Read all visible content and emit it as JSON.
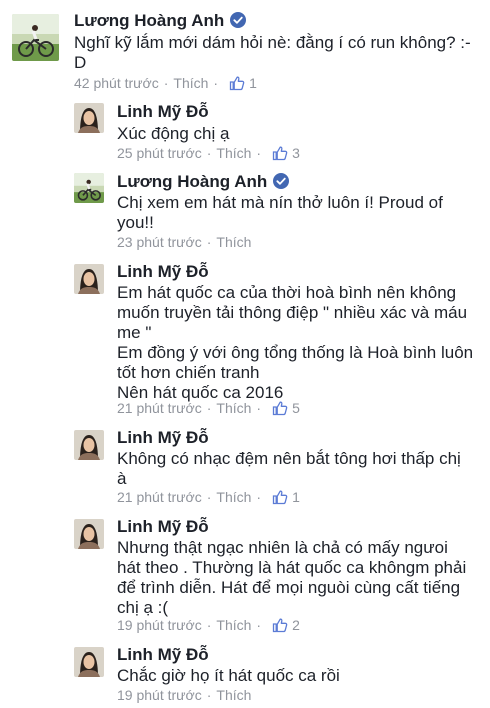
{
  "icons": {
    "verified": "verified-badge-icon",
    "like": "thumbs-up-icon"
  },
  "colors": {
    "text": "#1d2129",
    "meta": "#90949c",
    "verified": "#4267b2",
    "like": "#5b7bd5"
  },
  "comments": [
    {
      "author": "Lương Hoàng Anh",
      "verified": true,
      "lines": [
        "Nghĩ kỹ lắm mới dám hỏi nè: đằng í có run không? :-",
        "D"
      ],
      "time": "42 phút trước",
      "like_label": "Thích",
      "likes": "1"
    },
    {
      "author": "Linh Mỹ Đỗ",
      "verified": false,
      "lines": [
        "Xúc động chị ạ"
      ],
      "time": "25 phút trước",
      "like_label": "Thích",
      "likes": "3"
    },
    {
      "author": "Lương Hoàng Anh",
      "verified": true,
      "lines": [
        "Chị xem em hát mà nín thở luôn í! Proud of",
        "you!!"
      ],
      "time": "23 phút trước",
      "like_label": "Thích",
      "likes": null
    },
    {
      "author": "Linh Mỹ Đỗ",
      "verified": false,
      "lines": [
        "Em hát quốc ca của thời hoà bình nên không",
        "muốn truyền tải thông điệp \" nhiều xác và máu",
        "me \"",
        "Em đồng ý với ông tổng thống là Hoà bình luôn",
        "tốt hơn chiến tranh",
        "Nên hát quốc ca 2016"
      ],
      "time": "21 phút trước",
      "like_label": "Thích",
      "likes": "5"
    },
    {
      "author": "Linh Mỹ Đỗ",
      "verified": false,
      "lines": [
        "Không có nhạc đệm nên bắt tông hơi thấp chị",
        "à"
      ],
      "time": "21 phút trước",
      "like_label": "Thích",
      "likes": "1"
    },
    {
      "author": "Linh Mỹ Đỗ",
      "verified": false,
      "lines": [
        "Nhưng thật ngạc nhiên là chả có mấy ngưoi",
        "hát theo . Thường là hát quốc ca khôngm phải",
        "để trình diễn. Hát để mọi nguòi cùng cất tiếng",
        "chị ạ :("
      ],
      "time": "19 phút trước",
      "like_label": "Thích",
      "likes": "2"
    },
    {
      "author": "Linh Mỹ Đỗ",
      "verified": false,
      "lines": [
        "Chắc giờ họ ít hát quốc ca rồi"
      ],
      "time": "19 phút trước",
      "like_label": "Thích",
      "likes": null
    }
  ]
}
